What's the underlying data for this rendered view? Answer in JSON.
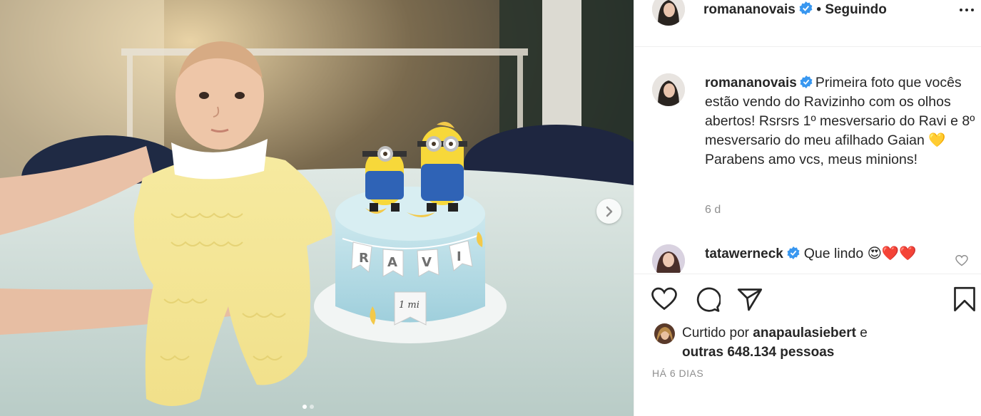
{
  "post": {
    "author": "romananovais",
    "follow_status": "• Seguindo",
    "caption_text": "Primeira foto que vocês estão vendo do Ravizinho com os olhos abertos! Rsrsrs 1º mesversario do Ravi e 8º mesversario do meu afilhado Gaian 💛 Parabens amo vcs, meus minions!",
    "caption_age": "6 d",
    "carousel_total_slides": 2,
    "carousel_active_slide": 1
  },
  "photo": {
    "banner_letters": [
      "R",
      "A",
      "V",
      "I"
    ],
    "tag_text": "1 mi"
  },
  "comment": {
    "author": "tatawerneck",
    "text": "Que lindo 😍❤️❤️"
  },
  "likes": {
    "prefix": "Curtido por",
    "liker": "anapaulasiebert",
    "conj": "e",
    "others": "outras 648.134 pessoas"
  },
  "timestamp": "HÁ 6 DIAS",
  "icons": {
    "next": "chevron-right-icon",
    "like": "heart-outline-icon",
    "comment": "speech-bubble-icon",
    "share": "paper-plane-icon",
    "save": "bookmark-icon",
    "verified": "verified-badge-icon",
    "more": "more-options-icon"
  },
  "colors": {
    "verified": "#3897f0",
    "text": "#262626",
    "muted": "#8e8e8e",
    "border": "#efefef"
  }
}
